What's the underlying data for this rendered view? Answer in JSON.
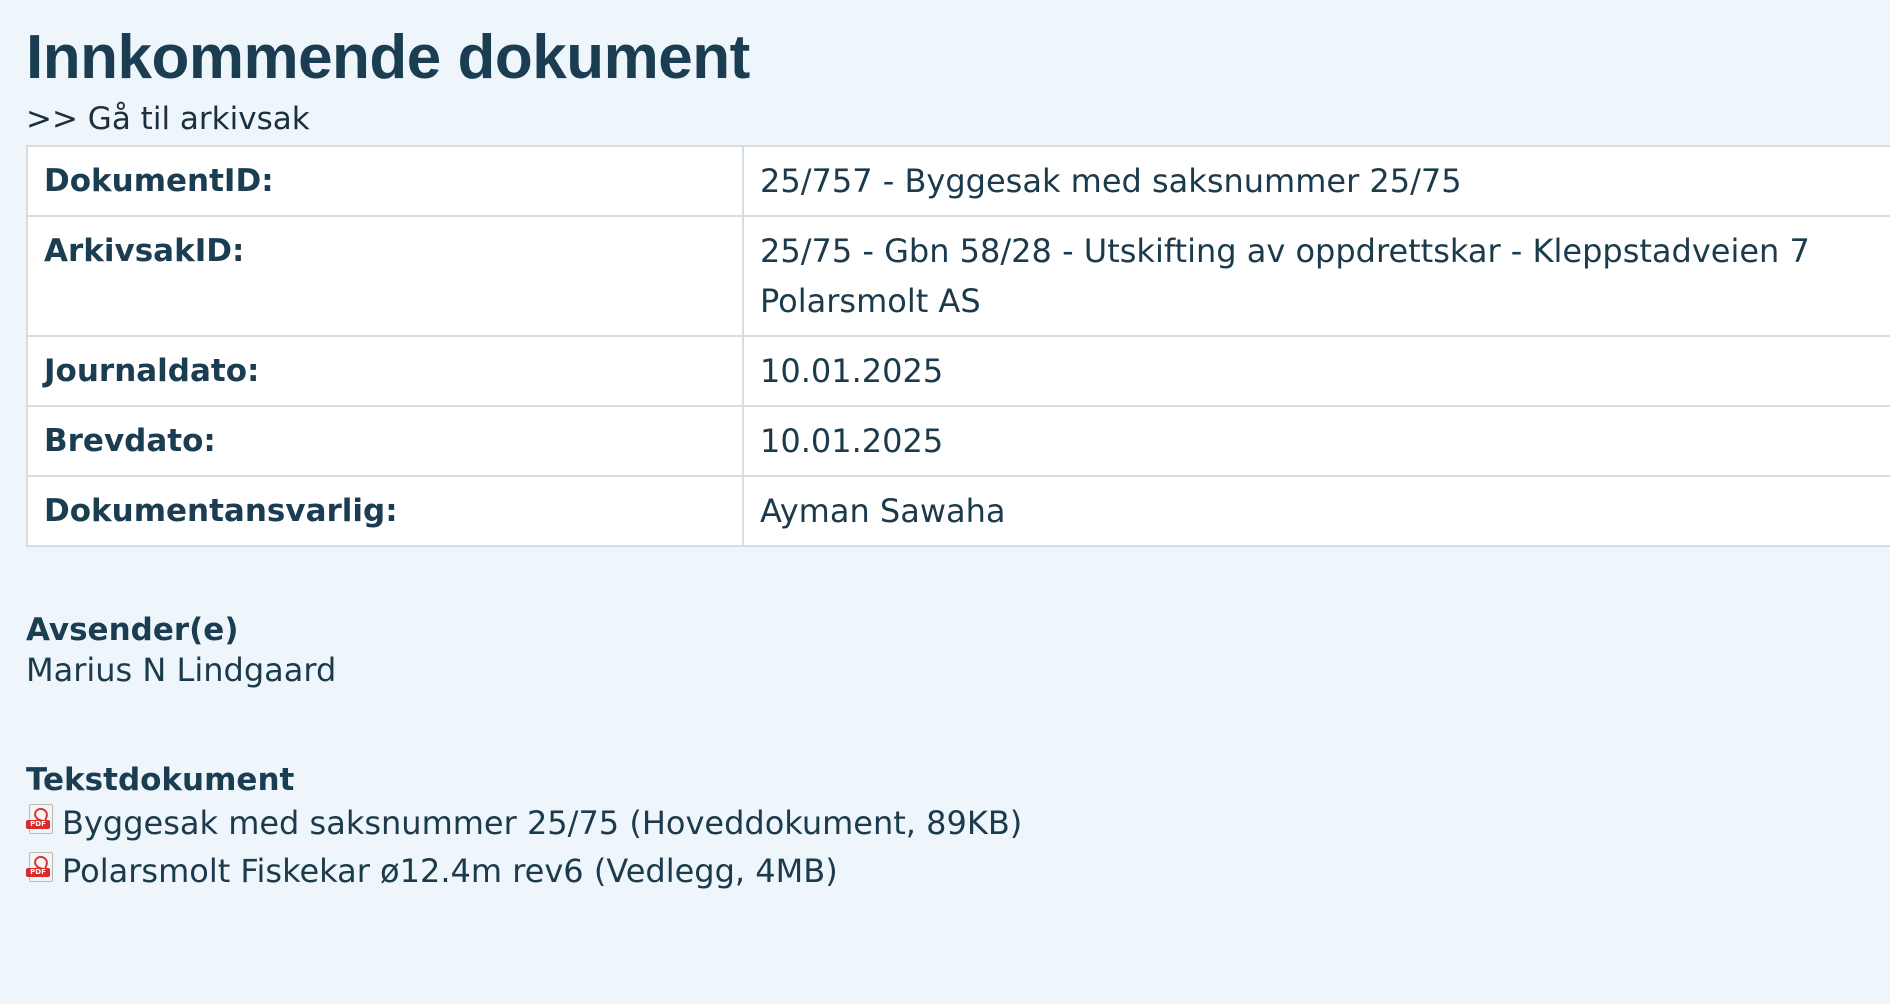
{
  "page": {
    "title": "Innkommende dokument",
    "back_link": ">> Gå til arkivsak"
  },
  "details": [
    {
      "label": "DokumentID:",
      "value": "25/757 - Byggesak med saksnummer 25/75"
    },
    {
      "label": "ArkivsakID:",
      "value": "25/75 - Gbn 58/28 - Utskifting av oppdrettskar - Kleppstadveien 7 Polarsmolt AS"
    },
    {
      "label": "Journaldato:",
      "value": "10.01.2025"
    },
    {
      "label": "Brevdato:",
      "value": "10.01.2025"
    },
    {
      "label": "Dokumentansvarlig:",
      "value": "Ayman Sawaha"
    }
  ],
  "sender": {
    "title": "Avsender(e)",
    "name": "Marius N Lindgaard"
  },
  "documents": {
    "title": "Tekstdokument",
    "icon_label": "PDF",
    "items": [
      {
        "name": "Byggesak med saksnummer 25/75 (Hoveddokument, 89KB)",
        "icon": "pdf-file-icon"
      },
      {
        "name": "Polarsmolt Fiskekar ø12.4m rev6 (Vedlegg, 4MB)",
        "icon": "pdf-file-icon"
      }
    ]
  }
}
